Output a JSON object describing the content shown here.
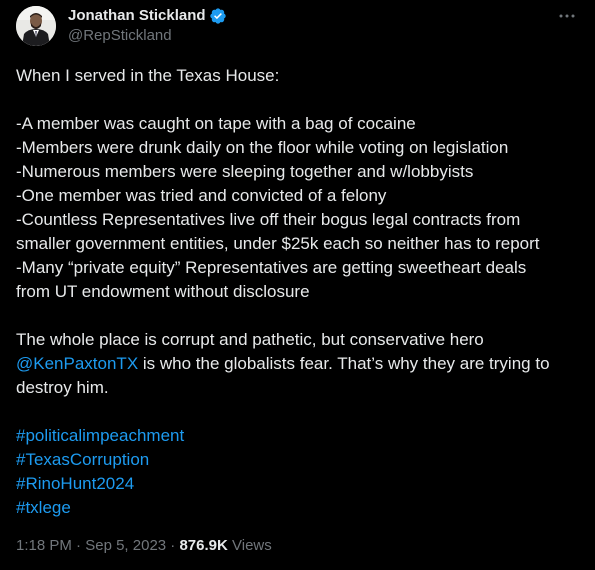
{
  "author": {
    "display_name": "Jonathan Stickland",
    "handle": "@RepStickland",
    "verified": true,
    "avatar_icon": "avatar-photo"
  },
  "tweet": {
    "lines": [
      "When I served in the Texas House:",
      "",
      "-A member was caught on tape with a bag of cocaine",
      "-Members were drunk daily on the floor while voting on legislation",
      "-Numerous members were sleeping together and w/lobbyists",
      "-One member was tried and convicted of a felony",
      "-Countless Representatives live off their bogus legal contracts from",
      "smaller government entities, under $25k each so neither has to report",
      "-Many “private equity” Representatives are getting sweetheart deals",
      "from UT endowment without disclosure",
      "",
      "The whole place is corrupt and pathetic, but conservative hero"
    ],
    "mention": "@KenPaxtonTX",
    "after_mention": " is who the globalists fear. That’s why they are trying to",
    "after_mention_line2": "destroy him.",
    "hashtags": [
      "#politicalimpeachment",
      "#TexasCorruption",
      "#RinoHunt2024",
      "#txlege"
    ]
  },
  "meta": {
    "time": "1:18 PM",
    "separator": " · ",
    "date": "Sep 5, 2023",
    "views_count": "876.9K",
    "views_label": " Views"
  },
  "colors": {
    "background": "#000000",
    "text": "#e7e9ea",
    "secondary": "#71767b",
    "link": "#1d9bf0",
    "verified": "#1d9bf0"
  },
  "icons": {
    "verified": "verified-badge-icon",
    "more": "more-options-icon"
  }
}
